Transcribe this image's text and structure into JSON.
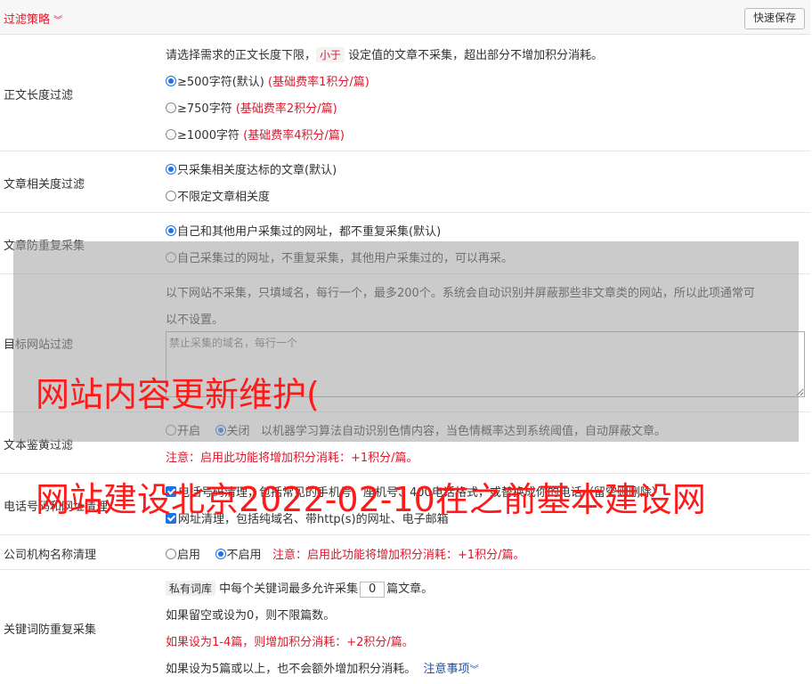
{
  "header": {
    "title": "过滤策略",
    "title_icon": "chevron-down-icon",
    "save_button": "快速保存"
  },
  "body_length": {
    "label": "正文长度过滤",
    "desc_pre": "请选择需求的正文长度下限，",
    "desc_tag": "小于",
    "desc_post": "设定值的文章不采集，超出部分不增加积分消耗。",
    "options": [
      {
        "label": "≥500字符(默认)",
        "rate": "(基础费率1积分/篇)",
        "selected": true
      },
      {
        "label": "≥750字符",
        "rate": "(基础费率2积分/篇)",
        "selected": false
      },
      {
        "label": "≥1000字符",
        "rate": "(基础费率4积分/篇)",
        "selected": false
      }
    ]
  },
  "relevance": {
    "label": "文章相关度过滤",
    "options": [
      {
        "label": "只采集相关度达标的文章(默认)",
        "selected": true
      },
      {
        "label": "不限定文章相关度",
        "selected": false
      }
    ]
  },
  "dedupe": {
    "label": "文章防重复采集",
    "options": [
      {
        "label": "自己和其他用户采集过的网址，都不重复采集(默认)",
        "selected": true
      },
      {
        "label": "自己采集过的网址，不重复采集，其他用户采集过的，可以再采。",
        "selected": false
      }
    ]
  },
  "site_filter": {
    "label": "目标网站过滤",
    "desc_line1": "以下网站不采集，只填域名，每行一个，最多200个。系统会自动识别并屏蔽那些非文章类的网站，所以此项通常可",
    "desc_line2": "以不设置。",
    "placeholder": "禁止采集的域名，每行一个"
  },
  "porn_filter": {
    "label": "文本鉴黄过滤",
    "on_label": "开启",
    "off_label": "关闭",
    "desc": "以机器学习算法自动识别色情内容，当色情概率达到系统阈值，自动屏蔽文章。",
    "note": "注意：启用此功能将增加积分消耗：+1积分/篇。"
  },
  "phone_url": {
    "label": "电话号码和网址清理",
    "phone_text": "电话号码清理，包括常见的手机号、座机号、400电话格式，或替换成你的电话（留空则删除）",
    "url_text": "网址清理，包括纯域名、带http(s)的网址、电子邮箱"
  },
  "org_name": {
    "label": "公司机构名称清理",
    "on_label": "启用",
    "off_label": "不启用",
    "note": "注意：启用此功能将增加积分消耗：+1积分/篇。"
  },
  "keyword": {
    "label": "关键词防重复采集",
    "tag": "私有词库",
    "line1_pre": "中每个关键词最多允许采集",
    "value": "0",
    "line1_post": "篇文章。",
    "line2": "如果留空或设为0，则不限篇数。",
    "line3": "如果设为1-4篇，则增加积分消耗：+2积分/篇。",
    "line4": "如果设为5篇或以上，也不会额外增加积分消耗。",
    "link": "注意事项"
  },
  "watermarks": [
    "网站内容更新维护(",
    "网站建设北京2022-02-10在之前基本建设网"
  ]
}
